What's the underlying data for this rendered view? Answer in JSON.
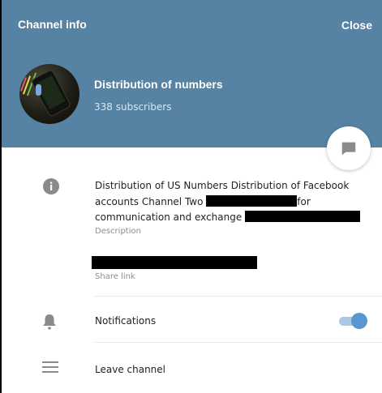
{
  "header": {
    "title": "Channel info",
    "close_label": "Close"
  },
  "channel": {
    "name": "Distribution of numbers",
    "subscribers": "338 subscribers"
  },
  "description": {
    "line1": "Distribution of US Numbers Distribution of Facebook",
    "line2a": "accounts Channel Two",
    "line2b": "for",
    "line3": "communication and exchange",
    "label": "Description"
  },
  "share_link": {
    "label": "Share link"
  },
  "notifications": {
    "label": "Notifications",
    "enabled": true
  },
  "leave": {
    "label": "Leave channel"
  },
  "colors": {
    "header_bg": "#5682a3",
    "toggle_on": "#5a96d0",
    "icon_gray": "#8a8a8a"
  },
  "icons": {
    "info": "info-icon",
    "bell": "bell-icon",
    "menu": "hamburger-menu-icon",
    "message": "message-icon"
  }
}
